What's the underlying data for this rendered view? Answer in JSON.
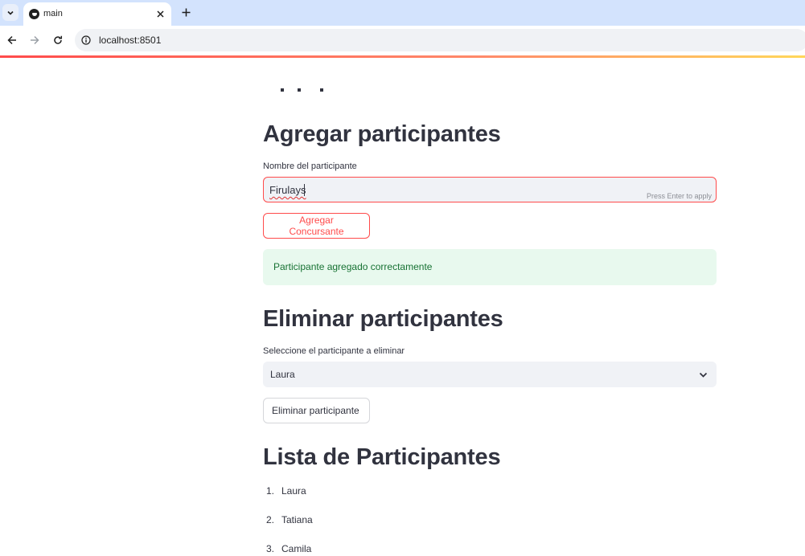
{
  "browser": {
    "tab_title": "main",
    "url": "localhost:8501",
    "icons": {
      "tab_list": "chevron-down-icon",
      "favicon": "streamlit-icon",
      "tab_close": "close-icon",
      "new_tab": "plus-icon",
      "back": "arrow-left-icon",
      "forward": "arrow-right-icon",
      "reload": "reload-icon",
      "site_info": "info-icon"
    }
  },
  "app": {
    "add_section": {
      "title": "Agregar participantes",
      "input_label": "Nombre del participante",
      "input_value": "Firulays",
      "input_hint": "Press Enter to apply",
      "button_label": "Agregar Concursante",
      "success_message": "Participante agregado correctamente"
    },
    "remove_section": {
      "title": "Eliminar participantes",
      "select_label": "Seleccione el participante a eliminar",
      "select_value": "Laura",
      "button_label": "Eliminar participante"
    },
    "list_section": {
      "title": "Lista de Participantes",
      "items": [
        {
          "number": "1.",
          "name": "Laura"
        },
        {
          "number": "2.",
          "name": "Tatiana"
        },
        {
          "number": "3.",
          "name": "Camila"
        }
      ]
    }
  },
  "colors": {
    "primary": "#ff4b4b",
    "text": "#31333f",
    "input_bg": "#f0f2f6",
    "success_bg": "#e8f9ee",
    "success_text": "#177233",
    "tabbar_bg": "#d3e3fd"
  }
}
